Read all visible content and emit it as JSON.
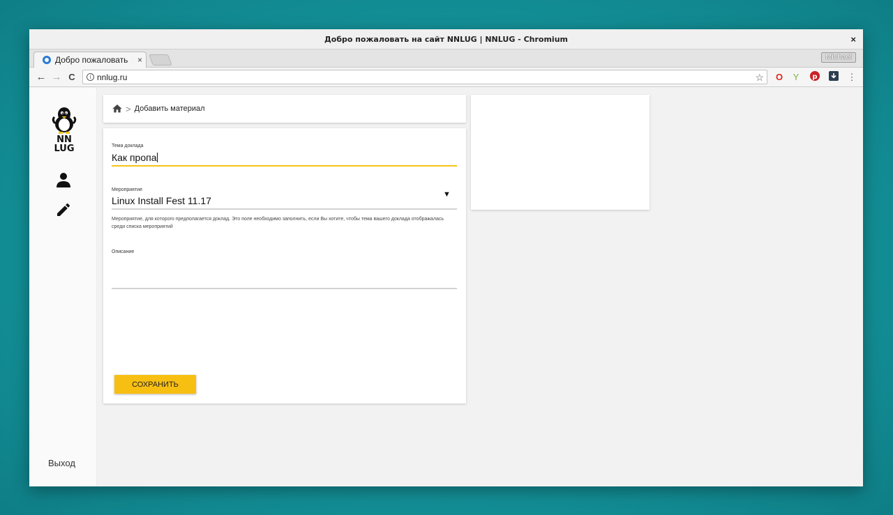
{
  "window": {
    "title": "Добро пожаловать на сайт NNLUG | NNLUG - Chromium",
    "close_glyph": "×"
  },
  "tabs": [
    {
      "label": "Добро пожаловать",
      "close_glyph": "×"
    }
  ],
  "profile": {
    "name": "Michael"
  },
  "toolbar": {
    "back": "←",
    "forward": "→",
    "reload": "C",
    "url": "nnlug.ru",
    "menu": "⋮"
  },
  "sidebar": {
    "logo_text_top": "NN",
    "logo_text_bottom": "LUG",
    "logout_label": "Выход"
  },
  "breadcrumb": {
    "current": "Добавить материал"
  },
  "form": {
    "topic": {
      "label": "Тема доклада",
      "value": "Как пропа"
    },
    "event": {
      "label": "Мероприятие",
      "value": "Linux Install Fest 11.17"
    },
    "event_hint": "Мероприятие, для которого предполагается доклад. Это поле необходимо заполнить, если Вы хотите, чтобы тема вашего доклада отображалась среди списка мероприятий",
    "description": {
      "label": "Описание",
      "value": ""
    },
    "save_label": "СОХРАНИТЬ"
  },
  "colors": {
    "accent": "#f8bf13",
    "active_underline": "#f5c518",
    "background": "#f2f2f2",
    "desktop": "#14939a"
  }
}
